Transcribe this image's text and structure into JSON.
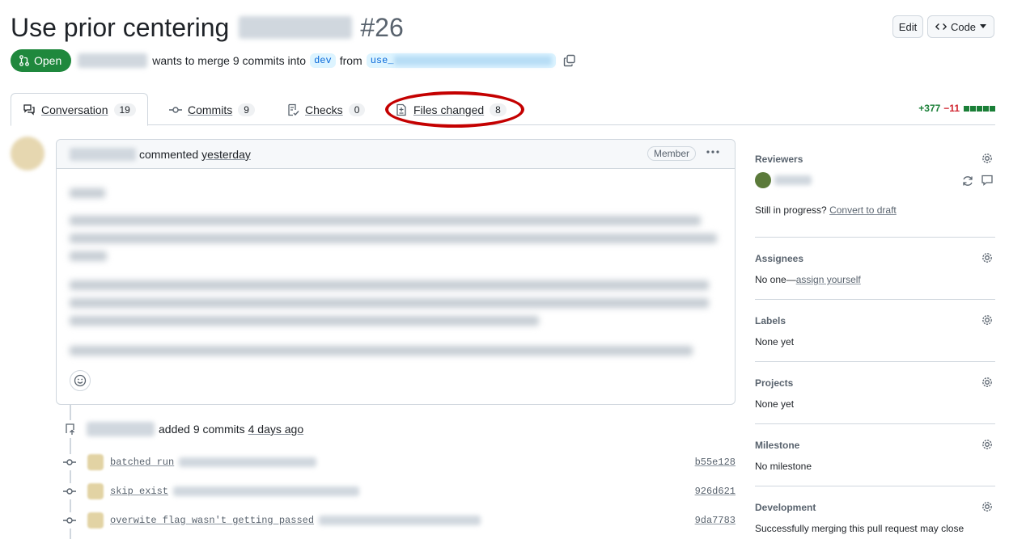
{
  "header": {
    "title": "Use prior centering",
    "pr_number": "#26",
    "edit_label": "Edit",
    "code_label": "Code"
  },
  "state": {
    "status": "Open",
    "merge_text": "wants to merge 9 commits into",
    "target_branch": "dev",
    "from_text": "from",
    "source_branch_prefix": "use_"
  },
  "tabs": [
    {
      "label": "Conversation",
      "count": "19"
    },
    {
      "label": "Commits",
      "count": "9"
    },
    {
      "label": "Checks",
      "count": "0"
    },
    {
      "label": "Files changed",
      "count": "8"
    }
  ],
  "diffstat": {
    "additions": "+377",
    "deletions": "−11"
  },
  "comment": {
    "action": "commented",
    "time": "yesterday",
    "role_badge": "Member"
  },
  "timeline": {
    "event_text": "added 9 commits",
    "event_time": "4 days ago",
    "commits": [
      {
        "message": "batched run",
        "sha": "b55e128"
      },
      {
        "message": "skip exist",
        "sha": "926d621"
      },
      {
        "message": "overwite flag wasn't getting passed",
        "sha": "9da7783"
      }
    ]
  },
  "sidebar": {
    "reviewers_title": "Reviewers",
    "still_in_progress": "Still in progress?",
    "convert_to_draft": "Convert to draft",
    "assignees_title": "Assignees",
    "assignees_none": "No one—",
    "assign_yourself": "assign yourself",
    "labels_title": "Labels",
    "labels_value": "None yet",
    "projects_title": "Projects",
    "projects_value": "None yet",
    "milestone_title": "Milestone",
    "milestone_value": "No milestone",
    "development_title": "Development",
    "development_value": "Successfully merging this pull request may close"
  },
  "colors": {
    "open_green": "#1f883d",
    "annotation_red": "#c40000",
    "addition_green": "#1a7f37",
    "deletion_red": "#d1242f"
  }
}
